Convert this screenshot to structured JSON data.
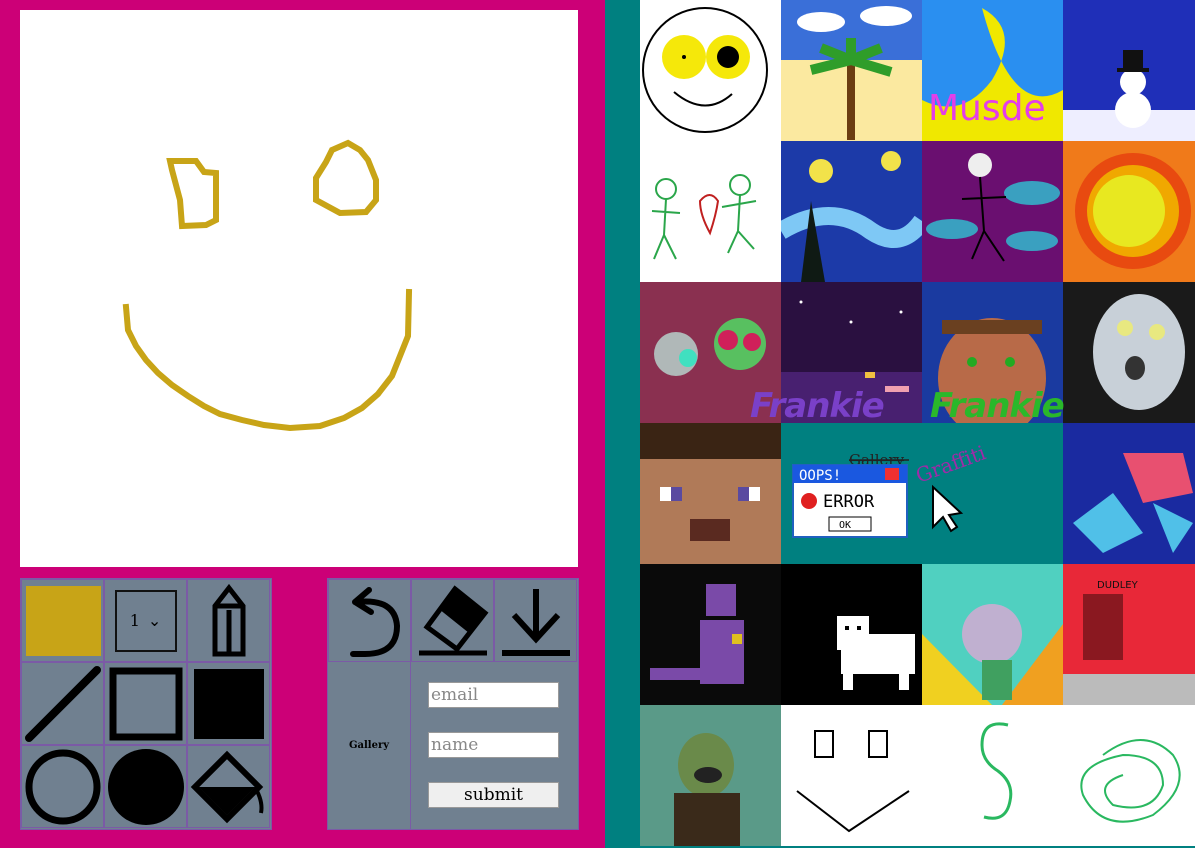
{
  "drawing": {
    "stroke_color": "#c8a417"
  },
  "toolbar": {
    "color_swatch": "#c8a417",
    "brush_size_value": "1",
    "brush_size_arrow": "⌄",
    "tools": [
      "pencil-tool",
      "line-tool",
      "rectangle-tool",
      "filled-rectangle-tool",
      "circle-tool",
      "filled-circle-tool",
      "fill-bucket-tool",
      "undo-tool",
      "eraser-tool",
      "download-tool"
    ]
  },
  "form": {
    "gallery_label": "Gallery",
    "email_placeholder": "email",
    "name_placeholder": "name",
    "submit_label": "submit"
  },
  "gallery": {
    "overlay_gallery_text": "Gallery",
    "overlay_graffiti_text": "Graffiti",
    "oops_title": "OOPS!",
    "oops_error": "ERROR",
    "oops_ok": "OK",
    "tile_musde_text": "Musde",
    "tile_dudley_text": "DUDLEY",
    "frankie_1": "Frankie",
    "frankie_2": "Frankie"
  }
}
